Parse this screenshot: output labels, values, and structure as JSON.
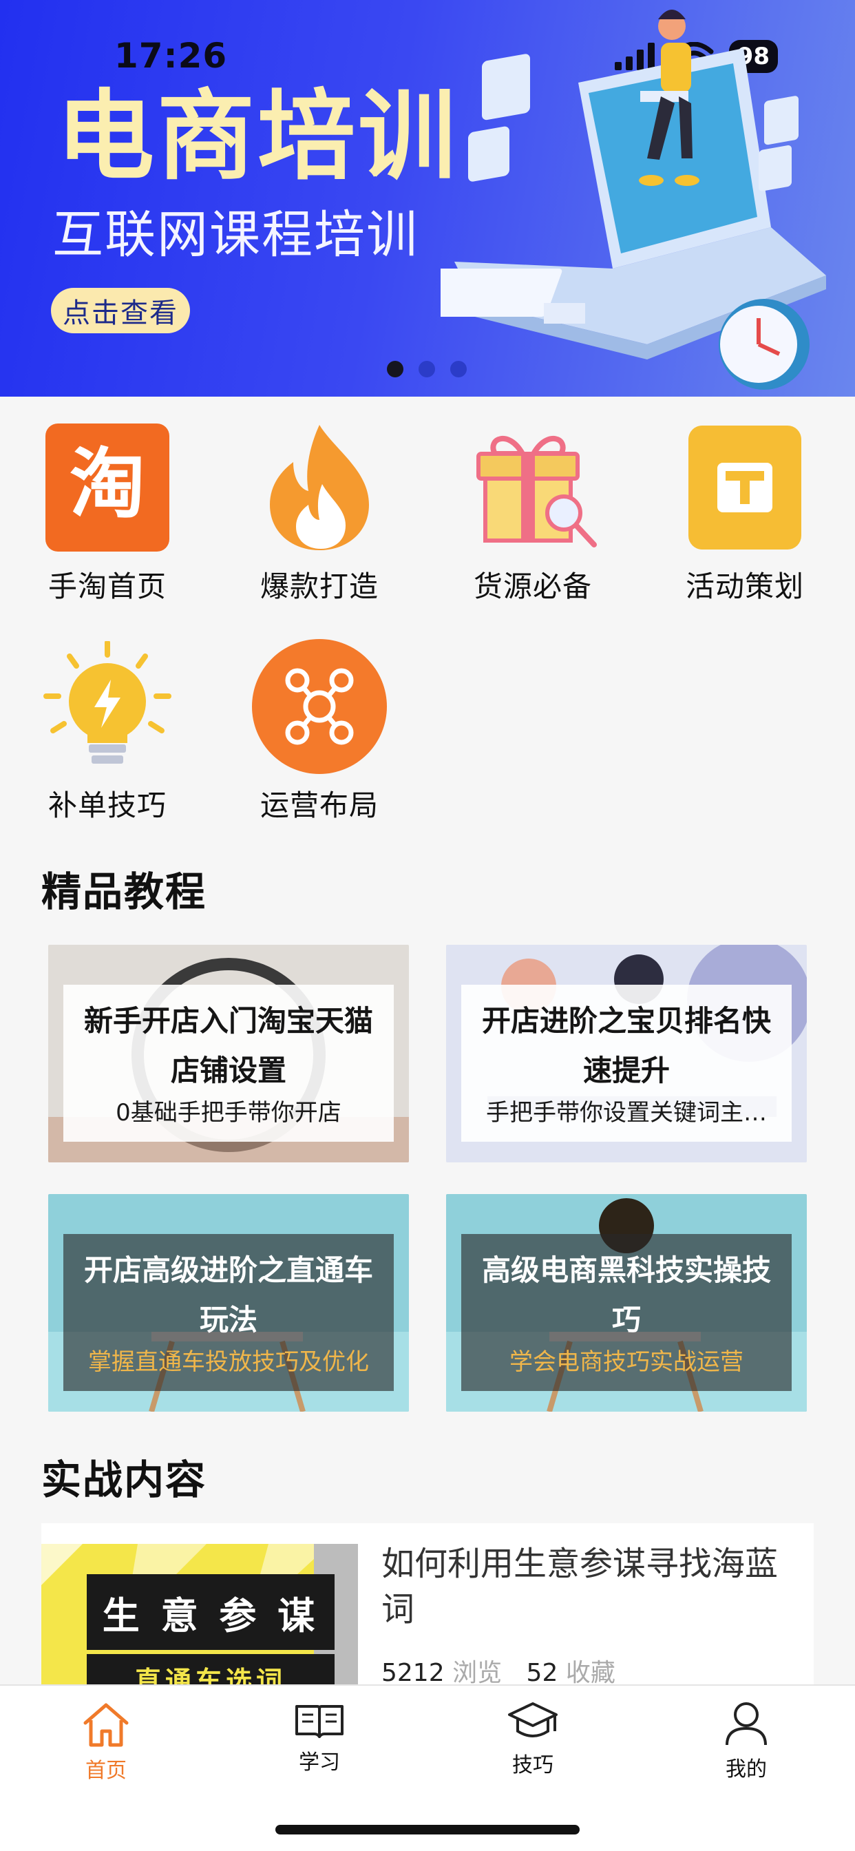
{
  "status_bar": {
    "time": "17:26",
    "battery": "98"
  },
  "banner": {
    "title": "电商培训",
    "subtitle": "互联网课程培训",
    "button_label": "点击查看",
    "page_count": 3,
    "active_page": 1
  },
  "quick_nav": [
    {
      "label": "手淘首页",
      "icon": "taobao-icon"
    },
    {
      "label": "爆款打造",
      "icon": "flame-icon"
    },
    {
      "label": "货源必备",
      "icon": "gift-box-icon"
    },
    {
      "label": "活动策划",
      "icon": "t-tag-icon"
    },
    {
      "label": "补单技巧",
      "icon": "lightbulb-icon"
    },
    {
      "label": "运营布局",
      "icon": "network-icon"
    }
  ],
  "featured": {
    "title": "精品教程",
    "courses": [
      {
        "title": "新手开店入门淘宝天猫店铺设置",
        "subtitle": "0基础手把手带你开店"
      },
      {
        "title": "开店进阶之宝贝排名快速提升",
        "subtitle": "手把手带你设置关键词主…"
      },
      {
        "title": "开店高级进阶之直通车玩法",
        "subtitle": "掌握直通车投放技巧及优化"
      },
      {
        "title": "高级电商黑科技实操技巧",
        "subtitle": "学会电商技巧实战运营"
      }
    ]
  },
  "practice": {
    "title": "实战内容",
    "items": [
      {
        "thumb_title": "生 意 参 谋",
        "thumb_subtitle": "直通车选词",
        "title": "如何利用生意参谋寻找海蓝词",
        "views": "5212",
        "views_label": "浏览",
        "favorites": "52",
        "favorites_label": "收藏"
      }
    ]
  },
  "tabbar": [
    {
      "label": "首页",
      "icon": "home-icon",
      "active": true
    },
    {
      "label": "学习",
      "icon": "book-icon",
      "active": false
    },
    {
      "label": "技巧",
      "icon": "graduation-cap-icon",
      "active": false
    },
    {
      "label": "我的",
      "icon": "person-icon",
      "active": false
    }
  ],
  "colors": {
    "accent": "#f07a2a",
    "banner": "#2230f0",
    "card_subtitle_highlight": "#f0b64a"
  }
}
